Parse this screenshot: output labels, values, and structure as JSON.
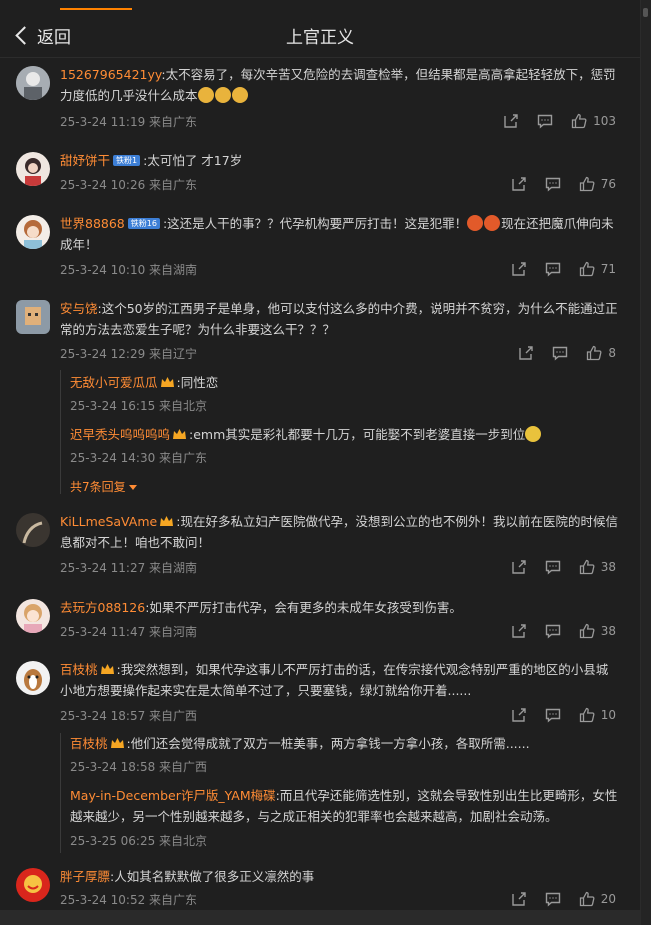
{
  "header": {
    "back_label": "返回",
    "title": "上官正义"
  },
  "colors": {
    "accent": "#ff8c35",
    "bg": "#1f1f1f",
    "text": "#d4d4d4",
    "meta": "#8a8a8a"
  },
  "comments": [
    {
      "user": "15267965421yy",
      "text": ":太不容易了，每次辛苦又危险的去调查检举，但结果都是高高拿起轻轻放下，惩罚力度低的几乎没什么成本",
      "time": "25-3-24 11:19 来自广东",
      "likes": "103"
    },
    {
      "user": "甜妤饼干",
      "badge": "铁粉1",
      "text": ":太可怕了 才17岁",
      "time": "25-3-24 10:26 来自广东",
      "likes": "76"
    },
    {
      "user": "世界88868",
      "badge": "铁粉16",
      "text": ":这还是人干的事？？代孕机构要严厉打击！这是犯罪！",
      "text2": "现在还把魔爪伸向未成年！",
      "time": "25-3-24 10:10 来自湖南",
      "likes": "71"
    },
    {
      "user": "安与饶",
      "text": ":这个50岁的江西男子是单身，他可以支付这么多的中介费，说明并不贫穷，为什么不能通过正常的方法去恋爱生子呢？为什么非要这么干？？？",
      "time": "25-3-24 12:29 来自辽宁",
      "likes": "8",
      "replies": [
        {
          "user": "无敌小可爱瓜瓜",
          "text": ":同性恋",
          "time": "25-3-24 16:15 来自北京"
        },
        {
          "user": "迟早秃头呜呜呜呜",
          "text": ":emm其实是彩礼都要十几万，可能娶不到老婆直接一步到位",
          "time": "25-3-24 14:30 来自广东"
        }
      ],
      "more_replies": "共7条回复"
    },
    {
      "user": "KiLLmeSaVAme",
      "text": ":现在好多私立妇产医院做代孕，没想到公立的也不例外！我以前在医院的时候信息都对不上！咱也不敢问！",
      "time": "25-3-24 11:27 来自湖南",
      "likes": "38"
    },
    {
      "user": "去玩方088126",
      "text": ":如果不严厉打击代孕，会有更多的未成年女孩受到伤害。",
      "time": "25-3-24 11:47 来自河南",
      "likes": "38"
    },
    {
      "user": "百枝桃",
      "text": ":我突然想到，如果代孕这事儿不严厉打击的话，在传宗接代观念特别严重的地区的小县城小地方想要操作起来实在是太简单不过了，只要塞钱，绿灯就给你开着......",
      "time": "25-3-24 18:57 来自广西",
      "likes": "10",
      "replies": [
        {
          "user": "百枝桃",
          "text": ":他们还会觉得成就了双方一桩美事，两方拿钱一方拿小孩，各取所需......",
          "time": "25-3-24 18:58 来自广西"
        },
        {
          "user": "May-in-December诈尸版_YAM梅碟",
          "text": ":而且代孕还能筛选性别，这就会导致性别出生比更畸形，女性越来越少，另一个性别越来越多，与之成正相关的犯罪率也会越来越高，加剧社会动荡。",
          "time": "25-3-25 06:25 来自北京"
        }
      ]
    },
    {
      "user": "胖子厚膘",
      "text": ":人如其名默默做了很多正义凛然的事",
      "time": "25-3-24 10:52 来自广东",
      "likes": "20"
    }
  ]
}
